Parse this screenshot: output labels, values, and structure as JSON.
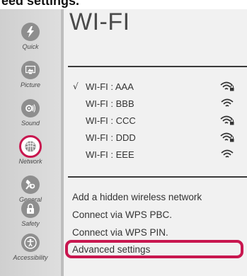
{
  "caption": "eed settings.",
  "panel": {
    "title": "WI-FI"
  },
  "sidebar": {
    "items": [
      {
        "label": "Quick",
        "icon": "quick-icon",
        "active": false
      },
      {
        "label": "Picture",
        "icon": "picture-icon",
        "active": false
      },
      {
        "label": "Sound",
        "icon": "sound-icon",
        "active": false
      },
      {
        "label": "Network",
        "icon": "network-icon",
        "active": true
      },
      {
        "label": "General",
        "icon": "general-icon",
        "active": false
      },
      {
        "label": "Safety",
        "icon": "lock-icon",
        "active": false
      },
      {
        "label": "Accessibility",
        "icon": "accessibility-icon",
        "active": false
      }
    ]
  },
  "networks": [
    {
      "name": "WI-FI : AAA",
      "checked_mark": "√",
      "secured": true
    },
    {
      "name": "WI-FI : BBB",
      "checked_mark": "",
      "secured": false
    },
    {
      "name": "WI-FI : CCC",
      "checked_mark": "",
      "secured": true
    },
    {
      "name": "WI-FI : DDD",
      "checked_mark": "",
      "secured": true
    },
    {
      "name": "WI-FI : EEE",
      "checked_mark": "",
      "secured": false
    }
  ],
  "options": {
    "hidden": "Add a hidden wireless network",
    "wps_pbc": "Connect via WPS PBC.",
    "wps_pin": "Connect via WPS PIN.",
    "advanced": "Advanced settings"
  },
  "colors": {
    "accent": "#c8174f",
    "sidebar_icon": "#8e8e8e",
    "text": "#333333"
  }
}
